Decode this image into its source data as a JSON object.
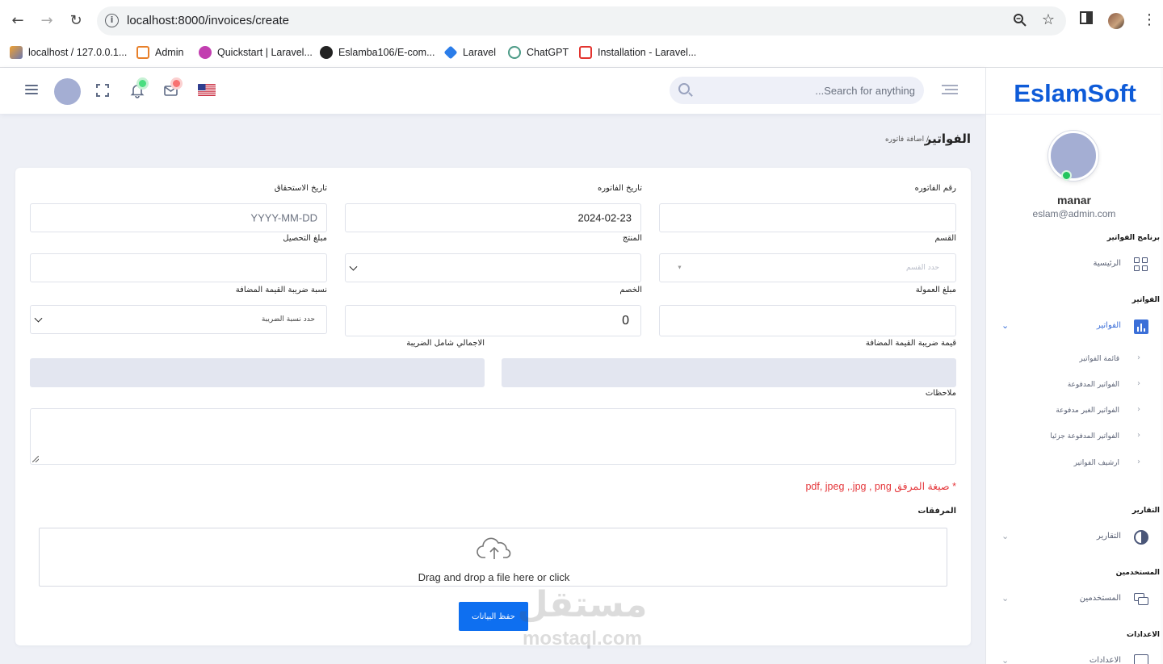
{
  "browser": {
    "url": "localhost:8000/invoices/create",
    "bookmarks": [
      {
        "label": "localhost / 127.0.0.1...",
        "icon": "phpmyadmin-icon",
        "color": "#f0a030"
      },
      {
        "label": "Admin",
        "icon": "admin-icon",
        "color": "#e8802a"
      },
      {
        "label": "Quickstart | Laravel...",
        "icon": "quickstart-icon",
        "color": "#c23fb0"
      },
      {
        "label": "Eslamba106/E-com...",
        "icon": "github-icon",
        "color": "#222222"
      },
      {
        "label": "Laravel",
        "icon": "laravel-diamond-icon",
        "color": "#2b7de9"
      },
      {
        "label": "ChatGPT",
        "icon": "chatgpt-icon",
        "color": "#4b9a86"
      },
      {
        "label": "Installation - Laravel...",
        "icon": "laravel-icon",
        "color": "#e3342f"
      }
    ]
  },
  "header": {
    "search_placeholder": "Search for anything..."
  },
  "sidebar": {
    "brand": "EslamSoft",
    "user_name": "manar",
    "user_email": "eslam@admin.com",
    "sections": {
      "program": "برنامج الفواتير",
      "invoices": "الفواتير",
      "reports": "التقارير",
      "users": "المستخدمين",
      "settings": "الاعدادات"
    },
    "items": {
      "home": "الرئيسية",
      "invoices": "الفواتير",
      "reports": "التقارير",
      "users": "المستخدمين",
      "settings": "الاعدادات"
    },
    "sub_items": [
      "قائمة الفواتير",
      "الفواتير المدفوعة",
      "الفواتير الغير مدفوعة",
      "الفواتير المدفوعة جزئيا",
      "ارشيف الفواتير"
    ]
  },
  "page": {
    "title": "الفواتير",
    "breadcrumb": "/ اضافة فاتوره"
  },
  "form": {
    "invoice_number_label": "رقم الفاتوره",
    "invoice_number_value": "",
    "invoice_date_label": "تاريخ الفاتوره",
    "invoice_date_value": "2024-02-23",
    "due_date_label": "تاريخ الاستحقاق",
    "due_date_placeholder": "YYYY-MM-DD",
    "section_label": "القسم",
    "section_placeholder": "حدد القسم",
    "product_label": "المنتج",
    "collection_amount_label": "مبلغ التحصيل",
    "commission_label": "مبلغ العمولة",
    "discount_label": "الخصم",
    "discount_value": "0",
    "vat_rate_label": "نسبة ضريبة القيمة المضافة",
    "vat_rate_placeholder": "حدد نسبة الضريبة",
    "vat_value_label": "قيمة ضريبة القيمة المضافة",
    "total_label": "الاجمالي شامل الضريبة",
    "notes_label": "ملاحظات",
    "attachment_note": "* صيغة المرفق pdf, jpeg ,.jpg , png",
    "attachments_label": "المرفقات",
    "dropzone_text": "Drag and drop a file here or click",
    "save_label": "حفظ البيانات"
  },
  "watermark": {
    "arabic": "مستقل",
    "latin": "mostaql.com"
  }
}
